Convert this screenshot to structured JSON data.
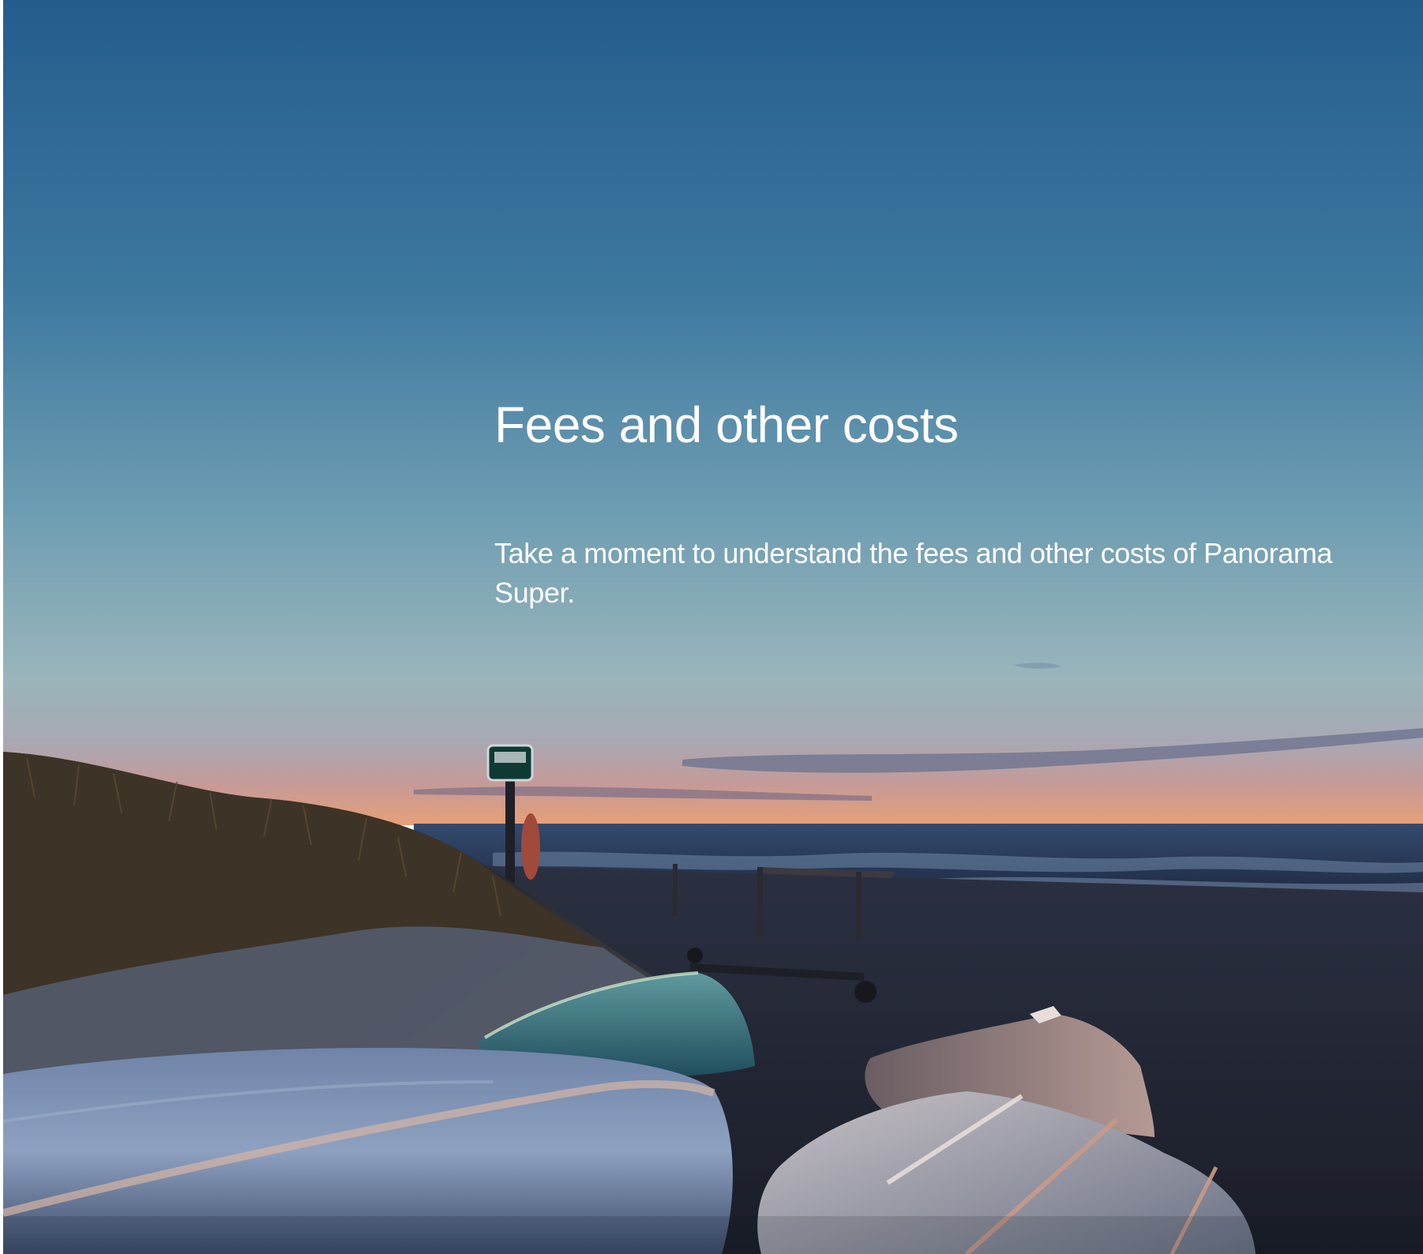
{
  "page": {
    "title": "Fees and other costs",
    "intro": "Take a moment to understand the fees and other costs of Panorama Super."
  },
  "hero_image": {
    "subject": "beach-at-dusk-with-upturned-boats",
    "colors": {
      "sky_top": "#2c6594",
      "sky_mid": "#5f93ac",
      "sky_low": "#98b5bb",
      "horizon_glow": "#d99983",
      "sea": "#2b3c5c",
      "sand": "#282d3c",
      "dune_grass": "#3a3124"
    }
  }
}
